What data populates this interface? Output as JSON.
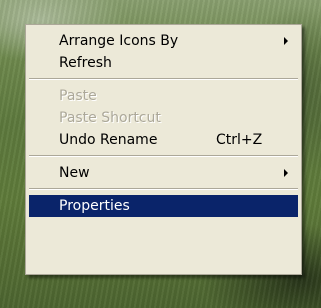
{
  "context_menu": {
    "items": [
      {
        "label": "Arrange Icons By",
        "enabled": true,
        "submenu": true
      },
      {
        "label": "Refresh",
        "enabled": true
      },
      {
        "label": "Paste",
        "enabled": false
      },
      {
        "label": "Paste Shortcut",
        "enabled": false
      },
      {
        "label": "Undo Rename",
        "enabled": true,
        "shortcut": "Ctrl+Z"
      },
      {
        "label": "New",
        "enabled": true,
        "submenu": true
      },
      {
        "label": "Properties",
        "enabled": true,
        "highlighted": true
      }
    ]
  },
  "colors": {
    "menu_background": "#ece9d8",
    "highlight": "#0a246a",
    "disabled_text": "#aca899"
  }
}
